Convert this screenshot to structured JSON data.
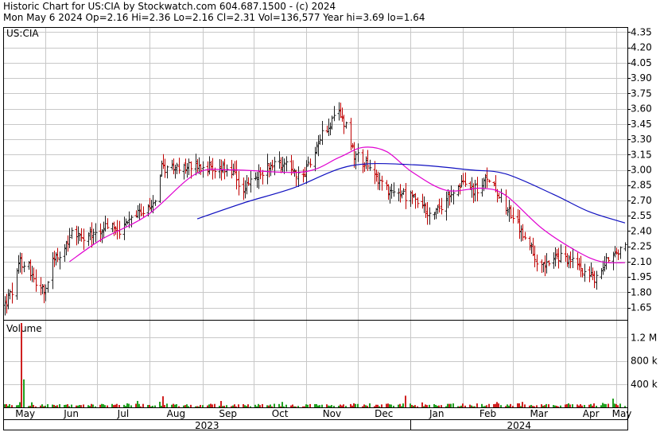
{
  "header": {
    "line1": "Historic Chart for US:CIA by Stockwatch.com 604.687.1500 - (c) 2024",
    "line2": "Mon May  6 2024  Op=2.16  Hi=2.36  Lo=2.16  Cl=2.31  Vol=136,577  Year hi=3.69  lo=1.64"
  },
  "chart_data": {
    "type": "ohlc",
    "symbol_label": "US:CIA",
    "volume_label": "Volume",
    "price_axis": {
      "ticks": [
        "4.35",
        "4.20",
        "4.05",
        "3.90",
        "3.75",
        "3.60",
        "3.45",
        "3.30",
        "3.15",
        "3.00",
        "2.85",
        "2.70",
        "2.55",
        "2.40",
        "2.25",
        "2.10",
        "1.95",
        "1.80",
        "1.65"
      ],
      "range": [
        1.53,
        4.4
      ],
      "grid": true
    },
    "volume_axis": {
      "ticks": [
        "1.2 M",
        "800 k",
        "400 k"
      ],
      "tick_values": [
        1200000,
        800000,
        400000
      ],
      "range": [
        0,
        1450000
      ]
    },
    "months": [
      "May",
      "Jun",
      "Jul",
      "Aug",
      "Sep",
      "Oct",
      "Nov",
      "Dec",
      "Jan",
      "Feb",
      "Mar",
      "Apr",
      "May"
    ],
    "years": [
      "2023",
      "2024"
    ],
    "price_anchors": [
      [
        "2023-05-08",
        1.68
      ],
      [
        "2023-05-12",
        1.8
      ],
      [
        "2023-05-17",
        2.1
      ],
      [
        "2023-05-22",
        2.05
      ],
      [
        "2023-05-26",
        1.9
      ],
      [
        "2023-05-31",
        1.78
      ],
      [
        "2023-06-05",
        2.1
      ],
      [
        "2023-06-12",
        2.2
      ],
      [
        "2023-06-16",
        2.42
      ],
      [
        "2023-06-23",
        2.3
      ],
      [
        "2023-06-30",
        2.38
      ],
      [
        "2023-07-07",
        2.45
      ],
      [
        "2023-07-14",
        2.4
      ],
      [
        "2023-07-21",
        2.52
      ],
      [
        "2023-07-28",
        2.58
      ],
      [
        "2023-08-04",
        2.72
      ],
      [
        "2023-08-08",
        3.02
      ],
      [
        "2023-08-18",
        3.0
      ],
      [
        "2023-08-28",
        3.05
      ],
      [
        "2023-09-08",
        3.02
      ],
      [
        "2023-09-18",
        2.98
      ],
      [
        "2023-09-25",
        2.8
      ],
      [
        "2023-10-02",
        2.92
      ],
      [
        "2023-10-10",
        3.05
      ],
      [
        "2023-10-20",
        3.08
      ],
      [
        "2023-10-30",
        2.9
      ],
      [
        "2023-11-03",
        3.1
      ],
      [
        "2023-11-10",
        3.35
      ],
      [
        "2023-11-20",
        3.55
      ],
      [
        "2023-11-24",
        3.45
      ],
      [
        "2023-11-29",
        3.15
      ],
      [
        "2023-12-06",
        3.05
      ],
      [
        "2023-12-13",
        2.9
      ],
      [
        "2023-12-20",
        2.8
      ],
      [
        "2023-12-28",
        2.75
      ],
      [
        "2024-01-05",
        2.72
      ],
      [
        "2024-01-12",
        2.55
      ],
      [
        "2024-01-19",
        2.62
      ],
      [
        "2024-01-26",
        2.82
      ],
      [
        "2024-02-02",
        2.85
      ],
      [
        "2024-02-09",
        2.8
      ],
      [
        "2024-02-16",
        2.92
      ],
      [
        "2024-02-23",
        2.75
      ],
      [
        "2024-03-01",
        2.52
      ],
      [
        "2024-03-08",
        2.35
      ],
      [
        "2024-03-15",
        2.12
      ],
      [
        "2024-03-22",
        2.08
      ],
      [
        "2024-03-29",
        2.15
      ],
      [
        "2024-04-05",
        2.1
      ],
      [
        "2024-04-12",
        2.02
      ],
      [
        "2024-04-19",
        1.92
      ],
      [
        "2024-04-26",
        2.15
      ],
      [
        "2024-05-02",
        2.22
      ],
      [
        "2024-05-06",
        2.31
      ]
    ],
    "ma_long_anchors": [
      [
        "2023-08-29",
        2.52
      ],
      [
        "2023-09-26",
        2.68
      ],
      [
        "2023-10-24",
        2.82
      ],
      [
        "2023-11-27",
        3.04
      ],
      [
        "2024-01-03",
        3.05
      ],
      [
        "2024-02-05",
        3.0
      ],
      [
        "2024-02-26",
        2.96
      ],
      [
        "2024-03-25",
        2.76
      ],
      [
        "2024-04-15",
        2.59
      ],
      [
        "2024-05-06",
        2.48
      ]
    ],
    "ma_short_anchors": [
      [
        "2023-06-15",
        2.1
      ],
      [
        "2023-07-04",
        2.32
      ],
      [
        "2023-07-31",
        2.56
      ],
      [
        "2023-08-28",
        2.96
      ],
      [
        "2023-09-18",
        3.0
      ],
      [
        "2023-10-30",
        2.98
      ],
      [
        "2023-11-20",
        3.12
      ],
      [
        "2023-12-04",
        3.22
      ],
      [
        "2023-12-18",
        3.18
      ],
      [
        "2024-01-02",
        2.98
      ],
      [
        "2024-01-22",
        2.8
      ],
      [
        "2024-02-12",
        2.82
      ],
      [
        "2024-02-26",
        2.75
      ],
      [
        "2024-03-18",
        2.43
      ],
      [
        "2024-04-08",
        2.2
      ],
      [
        "2024-04-22",
        2.1
      ],
      [
        "2024-05-06",
        2.09
      ]
    ],
    "volume_spikes": [
      [
        "2023-05-18",
        1450000
      ],
      [
        "2023-05-19",
        480000
      ],
      [
        "2023-07-25",
        110000
      ],
      [
        "2023-08-09",
        190000
      ],
      [
        "2023-12-29",
        200000
      ],
      [
        "2024-04-29",
        150000
      ]
    ],
    "colors": {
      "ohlc": "#202020",
      "ohlc_down": "#c00000",
      "ma_long": "#1010c0",
      "ma_short": "#e000d0",
      "volume_up": "#20a020",
      "volume_down": "#d02020",
      "grid": "#c8c8c8"
    }
  }
}
